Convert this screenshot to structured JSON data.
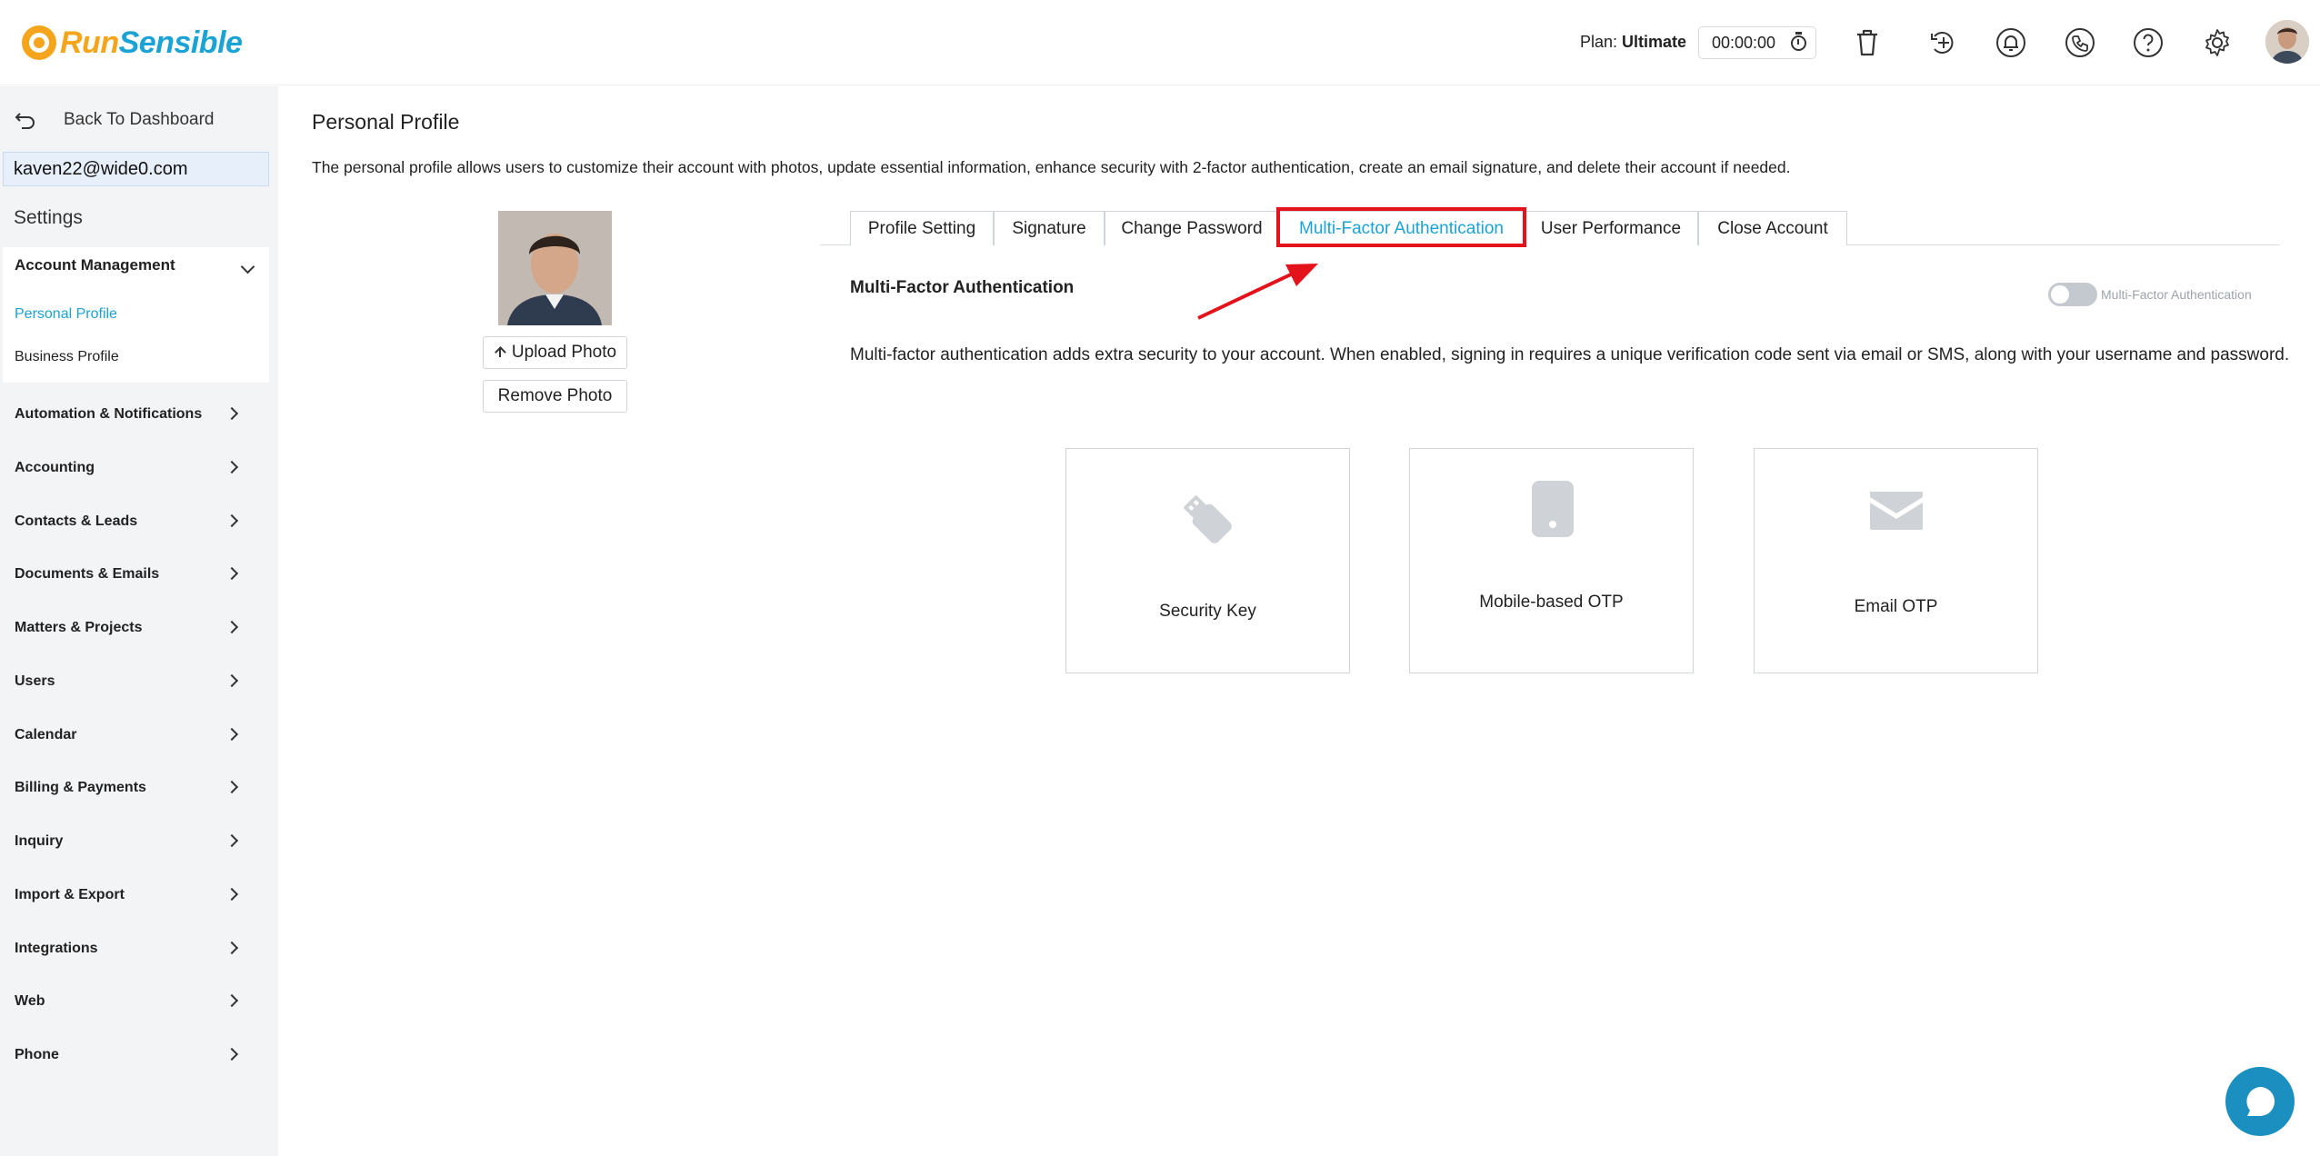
{
  "header": {
    "logo_run": "Run",
    "logo_sensible": "Sensible",
    "plan_prefix": "Plan: ",
    "plan_name": "Ultimate",
    "timer": "00:00:00"
  },
  "sidebar": {
    "back_label": "Back To Dashboard",
    "user_email": "kaven22@wide0.com",
    "settings_title": "Settings",
    "open_group": {
      "label": "Account Management",
      "items": [
        "Personal Profile",
        "Business Profile"
      ],
      "active": "Personal Profile"
    },
    "items": [
      "Automation & Notifications",
      "Accounting",
      "Contacts & Leads",
      "Documents & Emails",
      "Matters & Projects",
      "Users",
      "Calendar",
      "Billing & Payments",
      "Inquiry",
      "Import & Export",
      "Integrations",
      "Web",
      "Phone"
    ]
  },
  "main": {
    "page_title": "Personal Profile",
    "description": "The personal profile allows users to customize their account with photos, update essential information, enhance security with 2-factor authentication, create an email signature, and delete their account if needed.",
    "upload_label": "Upload Photo",
    "remove_label": "Remove Photo",
    "tabs": [
      "Profile Setting",
      "Signature",
      "Change Password",
      "Multi-Factor Authentication",
      "User Performance",
      "Close Account"
    ],
    "active_tab": "Multi-Factor Authentication",
    "mfa": {
      "title": "Multi-Factor Authentication",
      "toggle_label": "Multi-Factor Authentication",
      "toggle_on": false,
      "description": "Multi-factor authentication adds extra security to your account. When enabled, signing in requires a unique verification code sent via email or SMS, along with your username and password.",
      "options": [
        {
          "label": "Security Key",
          "icon": "usb-key-icon"
        },
        {
          "label": "Mobile-based OTP",
          "icon": "mobile-phone-icon"
        },
        {
          "label": "Email OTP",
          "icon": "envelope-icon"
        }
      ]
    }
  },
  "colors": {
    "brand_orange": "#f5a51c",
    "brand_blue": "#1ba3d6",
    "highlight_red": "#e3121b",
    "chat_button": "#1b8fc0"
  }
}
